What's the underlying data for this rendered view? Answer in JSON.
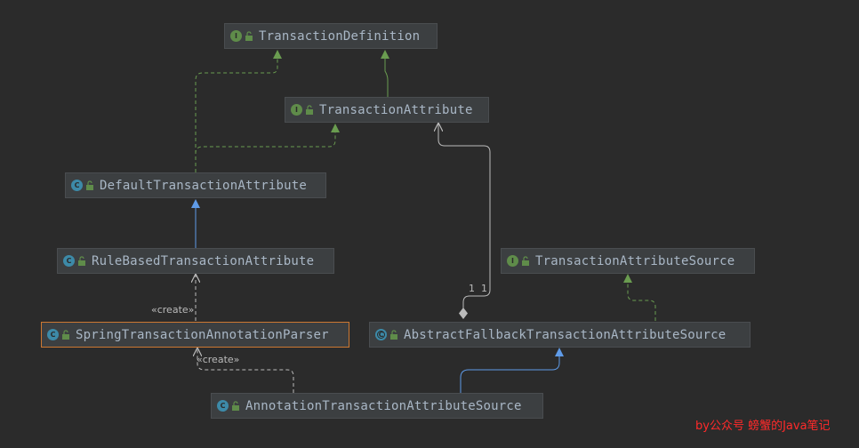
{
  "colors": {
    "background": "#2b2b2b",
    "node_fill": "#3c3f41",
    "node_text": "#a9b7c6",
    "interface_icon": "#5f8c4a",
    "class_icon": "#3d8aa8",
    "realization_edge": "#6a9c50",
    "generalization_edge": "#5f9be8",
    "dependency_edge": "#bbbbbb",
    "selection_border": "#cc7832",
    "watermark": "#ff2a2a"
  },
  "nodes": {
    "transaction_definition": {
      "name": "TransactionDefinition",
      "kind": "interface",
      "kind_letter": "I"
    },
    "transaction_attribute": {
      "name": "TransactionAttribute",
      "kind": "interface",
      "kind_letter": "I"
    },
    "default_transaction_attribute": {
      "name": "DefaultTransactionAttribute",
      "kind": "class",
      "kind_letter": "C"
    },
    "rule_based_transaction_attribute": {
      "name": "RuleBasedTransactionAttribute",
      "kind": "class",
      "kind_letter": "C"
    },
    "spring_transaction_annotation_parser": {
      "name": "SpringTransactionAnnotationParser",
      "kind": "class",
      "kind_letter": "C"
    },
    "transaction_attribute_source": {
      "name": "TransactionAttributeSource",
      "kind": "interface",
      "kind_letter": "I"
    },
    "abstract_fallback_transaction_attribute_source": {
      "name": "AbstractFallbackTransactionAttributeSource",
      "kind": "abstract-class",
      "kind_letter": "C"
    },
    "annotation_transaction_attribute_source": {
      "name": "AnnotationTransactionAttributeSource",
      "kind": "class",
      "kind_letter": "C"
    }
  },
  "edge_labels": {
    "create_rule_based": "«create»",
    "create_parser": "«create»",
    "multiplicity_source": "1",
    "multiplicity_target": "1"
  },
  "watermark": "by公众号  螃蟹的Java笔记"
}
